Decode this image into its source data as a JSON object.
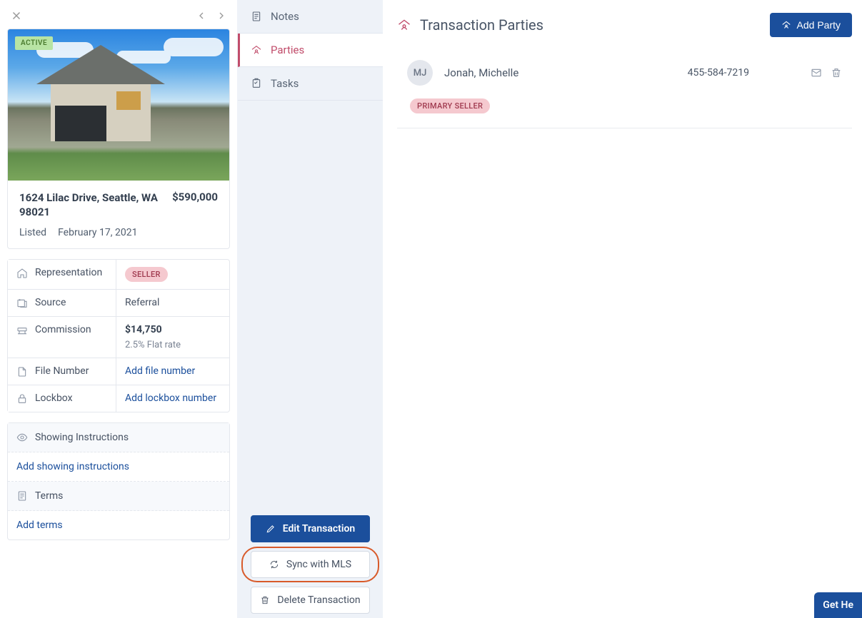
{
  "property": {
    "status_badge": "ACTIVE",
    "address": "1624 Lilac Drive, Seattle, WA 98021",
    "price": "$590,000",
    "listed_label": "Listed",
    "listed_date": "February 17, 2021"
  },
  "details": {
    "representation_label": "Representation",
    "representation_value": "SELLER",
    "source_label": "Source",
    "source_value": "Referral",
    "commission_label": "Commission",
    "commission_amount": "$14,750",
    "commission_rate": "2.5% Flat rate",
    "file_number_label": "File Number",
    "file_number_link": "Add file number",
    "lockbox_label": "Lockbox",
    "lockbox_link": "Add lockbox number"
  },
  "showing": {
    "header": "Showing Instructions",
    "link": "Add showing instructions"
  },
  "terms": {
    "header": "Terms",
    "link": "Add terms"
  },
  "nav": {
    "notes": "Notes",
    "parties": "Parties",
    "tasks": "Tasks"
  },
  "actions": {
    "edit": "Edit Transaction",
    "sync": "Sync with MLS",
    "delete": "Delete Transaction"
  },
  "main": {
    "title": "Transaction Parties",
    "add_party": "Add Party"
  },
  "parties": [
    {
      "initials": "MJ",
      "name": "Jonah, Michelle",
      "phone": "455-584-7219",
      "role": "PRIMARY SELLER"
    }
  ],
  "help_button": "Get He"
}
